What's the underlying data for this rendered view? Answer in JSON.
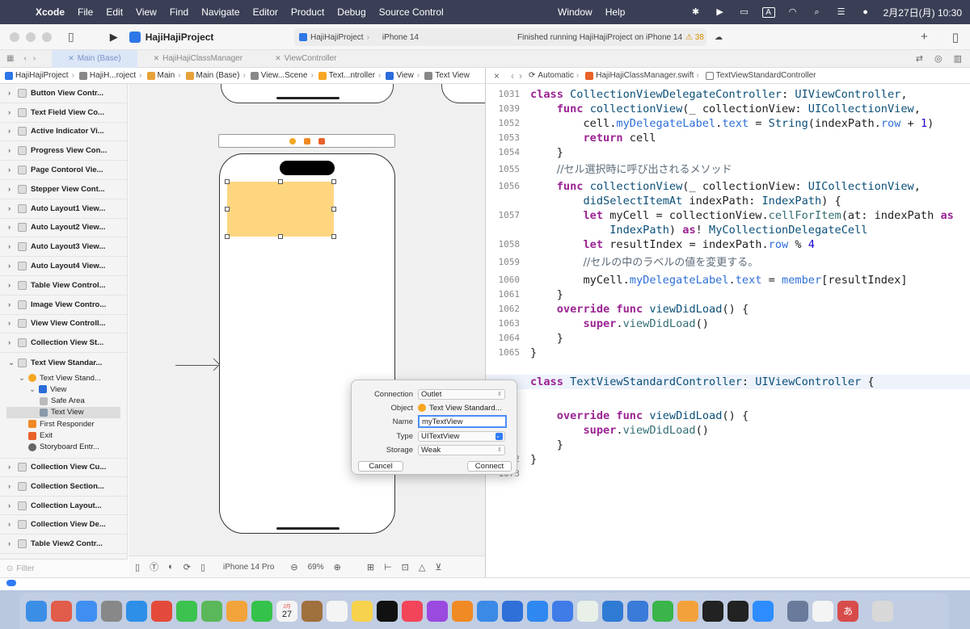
{
  "menubar": {
    "app_name": "Xcode",
    "items": [
      "File",
      "Edit",
      "View",
      "Find",
      "Navigate",
      "Editor",
      "Product",
      "Debug",
      "Source Control"
    ],
    "center_items": [
      "Window",
      "Help"
    ],
    "input_source": "A",
    "datetime": "2月27日(月)  10:30"
  },
  "toolbar": {
    "project_name": "HajiHajiProject",
    "scheme": "HajiHajiProject",
    "destination": "iPhone 14",
    "status_message": "Finished running HajiHajiProject on iPhone 14",
    "warning_count": "38"
  },
  "tabs": [
    {
      "label": "Main (Base)",
      "active": true
    },
    {
      "label": "HajiHajiClassManager",
      "active": false
    },
    {
      "label": "ViewController",
      "active": false
    }
  ],
  "left_jumpbar": [
    "HajiHajiProject",
    "HajiH...roject",
    "Main",
    "Main (Base)",
    "View...Scene",
    "Text...ntroller",
    "View",
    "Text View"
  ],
  "outline": {
    "scenes_top": [
      "Button View Contr...",
      "Text Field View Co...",
      "Active Indicator Vi...",
      "Progress View Con...",
      "Page Contorol Vie...",
      "Stepper View Cont...",
      "Auto Layout1 View...",
      "Auto Layout2 View...",
      "Auto Layout3 View...",
      "Auto Layout4 View...",
      "Table View Control...",
      "Image View Contro...",
      "View View Controll...",
      "Collection View St..."
    ],
    "expanded_scene": "Text View Standar...",
    "expanded_children": [
      {
        "label": "Text View Stand...",
        "indent": 1,
        "icon": "view-controller-icon",
        "color": "#f5a623"
      },
      {
        "label": "View",
        "indent": 2,
        "icon": "view-icon",
        "color": "#2c6bd9"
      },
      {
        "label": "Safe Area",
        "indent": 3,
        "icon": "safe-area-icon",
        "color": "#bbbbbb"
      },
      {
        "label": "Text View",
        "indent": 3,
        "icon": "text-view-icon",
        "color": "#8899aa",
        "selected": true
      },
      {
        "label": "First Responder",
        "indent": 1,
        "icon": "first-responder-icon",
        "color": "#f08a24"
      },
      {
        "label": "Exit",
        "indent": 1,
        "icon": "exit-icon",
        "color": "#e8622a"
      },
      {
        "label": "Storyboard Entr...",
        "indent": 1,
        "icon": "storyboard-entry-icon",
        "color": "#666666"
      }
    ],
    "scenes_bottom": [
      "Collection View Cu...",
      "Collection Section...",
      "Collection Layout...",
      "Collection View De...",
      "Table View2 Contr..."
    ],
    "filter_placeholder": "Filter"
  },
  "canvas": {
    "device": "iPhone 14 Pro",
    "zoom": "69%"
  },
  "editor_jumpbar": {
    "mode": "Automatic",
    "file": "HajiHajiClassManager.swift",
    "symbol": "TextViewStandardController"
  },
  "code_lines": [
    {
      "n": "1031",
      "html": "<span class=\"kw\">class</span> <span class=\"ty\">CollectionViewDelegateController</span>: <span class=\"ty\">UIViewController</span>,"
    },
    {
      "n": "1039",
      "html": "    <span class=\"kw\">func</span> <span class=\"ty\">collectionView</span>(_ collectionView: <span class=\"ty\">UICollectionView</span>,"
    },
    {
      "n": "1052",
      "html": "        cell.<span class=\"pr\">myDelegateLabel</span>.<span class=\"pr\">text</span> = <span class=\"ty\">String</span>(indexPath.<span class=\"pr\">row</span> + <span class=\"nm\">1</span>)"
    },
    {
      "n": "1053",
      "html": "        <span class=\"kw\">return</span> cell"
    },
    {
      "n": "1054",
      "html": "    }"
    },
    {
      "n": "1055",
      "html": "    <span class=\"cm\">//セル選択時に呼び出されるメソッド</span>"
    },
    {
      "n": "1056",
      "html": "    <span class=\"kw\">func</span> <span class=\"ty\">collectionView</span>(_ collectionView: <span class=\"ty\">UICollectionView</span>,"
    },
    {
      "n": "",
      "html": "        <span class=\"ty\">didSelectItemAt</span> indexPath: <span class=\"ty\">IndexPath</span>) {"
    },
    {
      "n": "1057",
      "html": "        <span class=\"kw\">let</span> myCell = collectionView.<span class=\"fn\">cellForItem</span>(at: indexPath <span class=\"kw\">as</span>"
    },
    {
      "n": "",
      "html": "            <span class=\"ty\">IndexPath</span>) <span class=\"kw\">as</span>! <span class=\"ty\">MyCollectionDelegateCell</span>"
    },
    {
      "n": "1058",
      "html": "        <span class=\"kw\">let</span> resultIndex = indexPath.<span class=\"pr\">row</span> % <span class=\"nm\">4</span>"
    },
    {
      "n": "1059",
      "html": "        <span class=\"cm\">//セルの中のラベルの値を変更する。</span>"
    },
    {
      "n": "1060",
      "html": "        myCell.<span class=\"pr\">myDelegateLabel</span>.<span class=\"pr\">text</span> = <span class=\"pr\">member</span>[resultIndex]"
    },
    {
      "n": "1061",
      "html": "    }"
    },
    {
      "n": "1062",
      "html": "    <span class=\"kw\">override</span> <span class=\"kw\">func</span> <span class=\"ty\">viewDidLoad</span>() {"
    },
    {
      "n": "1063",
      "html": "        <span class=\"kw\">super</span>.<span class=\"fn\">viewDidLoad</span>()"
    },
    {
      "n": "1064",
      "html": "    }"
    },
    {
      "n": "1065",
      "html": "}"
    },
    {
      "n": "",
      "html": ""
    },
    {
      "n": "",
      "html": "<span class=\"kw\">class</span> <span class=\"ty\">TextViewStandardController</span>: <span class=\"ty\">UIViewController</span> {",
      "hl": true
    },
    {
      "n": "",
      "html": ""
    },
    {
      "n": "",
      "html": "    <span class=\"kw\">override</span> <span class=\"kw\">func</span> <span class=\"ty\">viewDidLoad</span>() {"
    },
    {
      "n": "",
      "html": "        <span class=\"kw\">super</span>.<span class=\"fn\">viewDidLoad</span>()"
    },
    {
      "n": "",
      "html": "    }"
    },
    {
      "n": "1072",
      "html": "}"
    },
    {
      "n": "1073",
      "html": ""
    }
  ],
  "outlet_popup": {
    "connection_label": "Connection",
    "connection_value": "Outlet",
    "object_label": "Object",
    "object_value": "Text View Standard...",
    "name_label": "Name",
    "name_value": "myTextView",
    "type_label": "Type",
    "type_value": "UITextView",
    "storage_label": "Storage",
    "storage_value": "Weak",
    "cancel_label": "Cancel",
    "connect_label": "Connect"
  },
  "dock_apps": [
    {
      "name": "finder-icon",
      "color": "#3b8ee6"
    },
    {
      "name": "launchpad-icon",
      "color": "#e25c4a"
    },
    {
      "name": "mail-icon",
      "color": "#3f8ff2"
    },
    {
      "name": "system-settings-icon",
      "color": "#888888"
    },
    {
      "name": "safari-icon",
      "color": "#2d8fe8"
    },
    {
      "name": "chrome-icon",
      "color": "#e44a3b"
    },
    {
      "name": "messages-icon",
      "color": "#3cc24f"
    },
    {
      "name": "maps-icon",
      "color": "#5ab85a"
    },
    {
      "name": "photos-icon",
      "color": "#f2a43a"
    },
    {
      "name": "facetime-icon",
      "color": "#35c24a"
    },
    {
      "name": "calendar-icon",
      "color": "#f4f4f4"
    },
    {
      "name": "notebook-icon",
      "color": "#a0703d"
    },
    {
      "name": "reminders-icon",
      "color": "#f4f4f4"
    },
    {
      "name": "notes-icon",
      "color": "#f7d24c"
    },
    {
      "name": "tv-icon",
      "color": "#111111"
    },
    {
      "name": "music-icon",
      "color": "#f2455a"
    },
    {
      "name": "podcasts-icon",
      "color": "#9b4ae0"
    },
    {
      "name": "books-icon",
      "color": "#f08a24"
    },
    {
      "name": "xcode-icon",
      "color": "#3a8ae6"
    },
    {
      "name": "simulator-icon",
      "color": "#2e6fd8"
    },
    {
      "name": "app-store-icon",
      "color": "#2f88f0"
    },
    {
      "name": "testflight-icon",
      "color": "#3f7ce8"
    },
    {
      "name": "numbers-icon",
      "color": "#e8f0e8"
    },
    {
      "name": "vscode-icon",
      "color": "#2f7bd4"
    },
    {
      "name": "keynote-icon",
      "color": "#3a7ad8"
    },
    {
      "name": "numbers2-icon",
      "color": "#39b54a"
    },
    {
      "name": "pages-icon",
      "color": "#f3a23b"
    },
    {
      "name": "github-icon",
      "color": "#222222"
    },
    {
      "name": "terminal-icon",
      "color": "#222222"
    },
    {
      "name": "zoom-icon",
      "color": "#2d8cff"
    },
    {
      "name": "preview-icon",
      "color": "#6a7a9a"
    },
    {
      "name": "textedit-icon",
      "color": "#f4f4f4"
    },
    {
      "name": "kotoeri-icon",
      "color": "#d84b4b"
    },
    {
      "name": "trash-icon",
      "color": "#d8d8d8"
    }
  ],
  "calendar_day": "27",
  "calendar_month": "2月",
  "kotoeri_char": "あ",
  "colors": {
    "accent": "#2f7bf5",
    "text_view_fill": "#ffd680",
    "keyword": "#9b2393",
    "type": "#0b4f79"
  }
}
